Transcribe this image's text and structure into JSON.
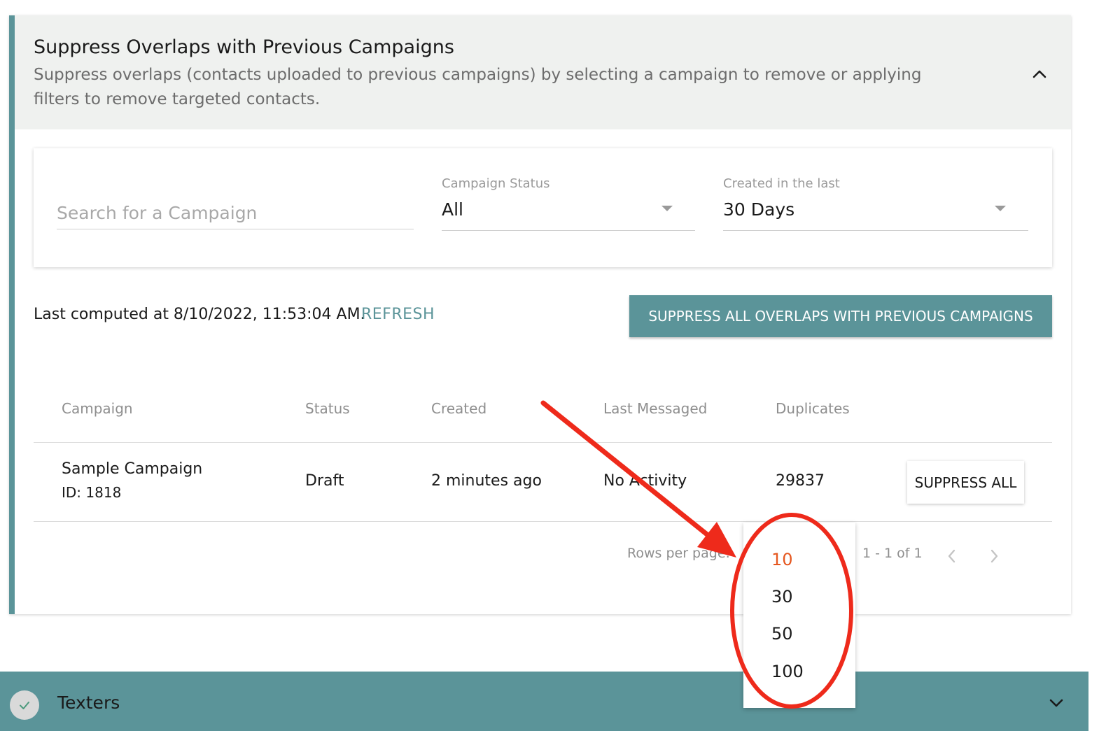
{
  "section": {
    "title": "Suppress Overlaps with Previous Campaigns",
    "description": "Suppress overlaps (contacts uploaded to previous campaigns) by selecting a campaign to remove or applying filters to remove targeted contacts."
  },
  "filters": {
    "search_placeholder": "Search for a Campaign",
    "status_label": "Campaign Status",
    "status_value": "All",
    "created_label": "Created in the last",
    "created_value": "30 Days"
  },
  "compute": {
    "last_computed": "Last computed at 8/10/2022, 11:53:04 AM.",
    "refresh_label": "REFRESH",
    "suppress_all_overlaps_label": "SUPPRESS ALL OVERLAPS WITH PREVIOUS CAMPAIGNS"
  },
  "table": {
    "columns": [
      "Campaign",
      "Status",
      "Created",
      "Last Messaged",
      "Duplicates"
    ],
    "rows": [
      {
        "campaign": "Sample Campaign",
        "id": "ID: 1818",
        "status": "Draft",
        "created": "2 minutes ago",
        "last_messaged": "No Activity",
        "duplicates": "29837",
        "action_label": "SUPPRESS ALL"
      }
    ]
  },
  "pagination": {
    "rows_per_page_label": "Rows per page:",
    "range": "1 - 1 of 1",
    "options": [
      "10",
      "30",
      "50",
      "100"
    ],
    "selected": "10"
  },
  "texters": {
    "label": "Texters"
  },
  "colors": {
    "accent": "#5b9499",
    "selected_option": "#e5571f",
    "annotation": "#ee2a1b"
  }
}
